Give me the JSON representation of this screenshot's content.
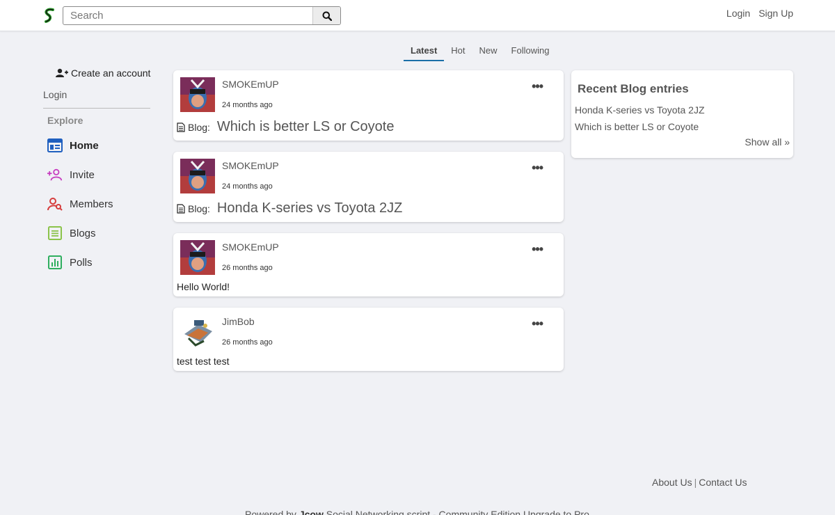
{
  "header": {
    "search_placeholder": "Search",
    "login": "Login",
    "signup": "Sign Up"
  },
  "tabs": [
    {
      "label": "Latest",
      "active": true
    },
    {
      "label": "Hot"
    },
    {
      "label": "New"
    },
    {
      "label": "Following"
    }
  ],
  "sidebar": {
    "create_account": "Create an account",
    "login": "Login",
    "explore": "Explore",
    "items": [
      {
        "label": "Home",
        "icon": "home-icon",
        "color": "#1f5fbf"
      },
      {
        "label": "Invite",
        "icon": "invite-icon",
        "color": "#c73ec0"
      },
      {
        "label": "Members",
        "icon": "members-icon",
        "color": "#d63c3c"
      },
      {
        "label": "Blogs",
        "icon": "blogs-icon",
        "color": "#8bc34a"
      },
      {
        "label": "Polls",
        "icon": "polls-icon",
        "color": "#2fae5f"
      }
    ]
  },
  "posts": [
    {
      "author": "SMOKEmUP",
      "time": "24 months ago",
      "prefix": "Blog:",
      "title": "Which is better LS or Coyote"
    },
    {
      "author": "SMOKEmUP",
      "time": "24 months ago",
      "prefix": "Blog:",
      "title": "Honda K-series vs Toyota 2JZ"
    },
    {
      "author": "SMOKEmUP",
      "time": "26 months ago",
      "text": "Hello World!"
    },
    {
      "author": "JimBob",
      "time": "26 months ago",
      "text": "test test test"
    }
  ],
  "recent_blogs": {
    "title": "Recent Blog entries",
    "items": [
      "Honda K-series vs Toyota 2JZ",
      "Which is better LS or Coyote"
    ],
    "show_all": "Show all »"
  },
  "footer": {
    "about": "About Us",
    "separator": "|",
    "contact": "Contact Us",
    "powered_prefix": "Powered by",
    "powered_brand": "Jcow",
    "powered_suffix": "Social Networking script - Community Edition Upgrade to Pro"
  }
}
